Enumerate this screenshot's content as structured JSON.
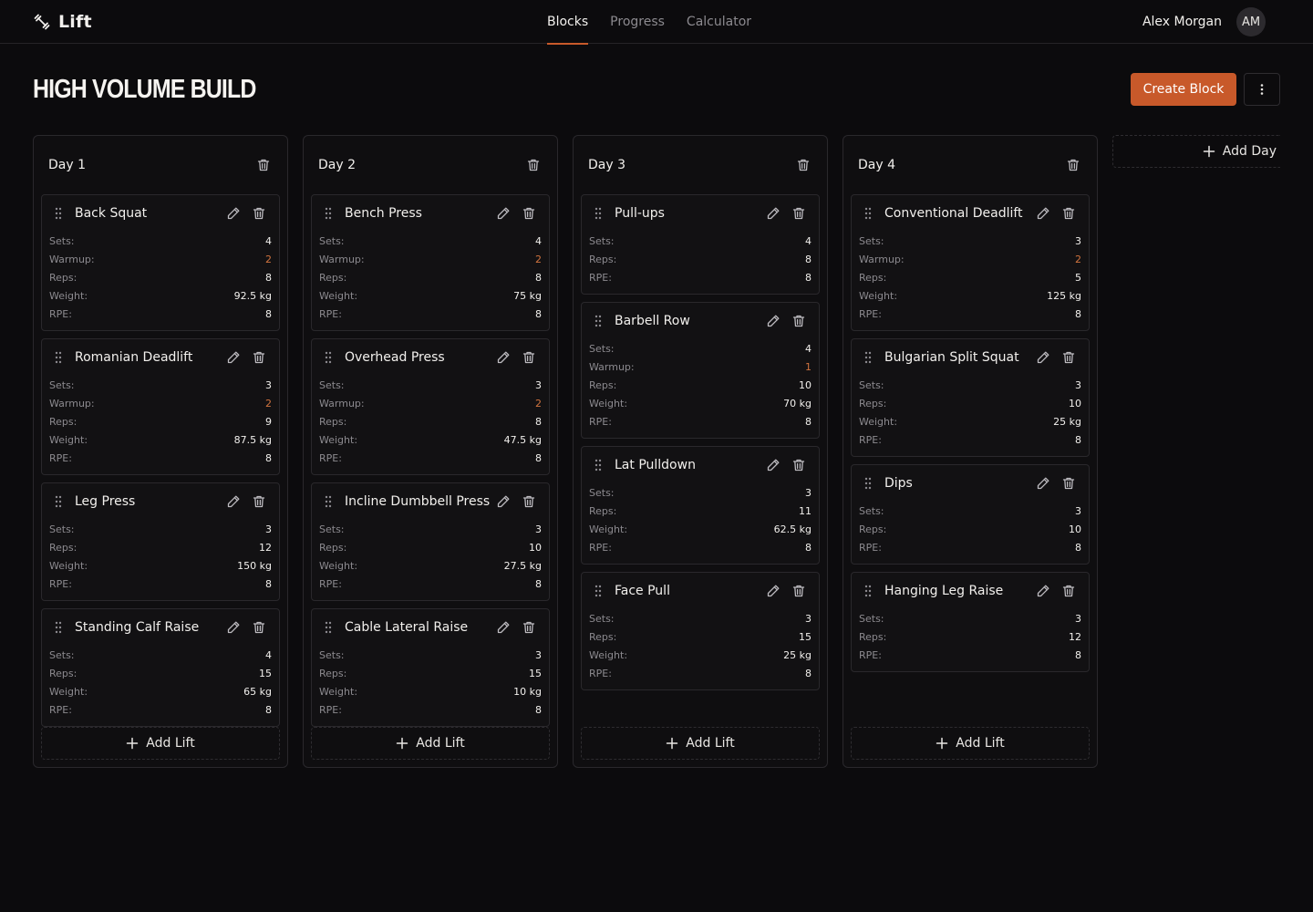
{
  "app": {
    "name": "Lift"
  },
  "nav": {
    "items": [
      "Blocks",
      "Progress",
      "Calculator"
    ],
    "active": 0
  },
  "user": {
    "name": "Alex Morgan",
    "initials": "AM"
  },
  "block": {
    "title": "HIGH VOLUME BUILD"
  },
  "actions": {
    "create_label": "Create Block",
    "add_day_label": "Add Day",
    "add_lift_label": "Add Lift"
  },
  "labels": {
    "sets": "Sets:",
    "warmup": "Warmup:",
    "reps": "Reps:",
    "weight": "Weight:",
    "rpe": "RPE:"
  },
  "colors": {
    "accent": "#c8592a",
    "warmup": "#d2743f"
  },
  "days": [
    {
      "title": "Day 1",
      "lifts": [
        {
          "name": "Back Squat",
          "sets": "4",
          "warmup": "2",
          "reps": "8",
          "weight": "92.5 kg",
          "rpe": "8"
        },
        {
          "name": "Romanian Deadlift",
          "sets": "3",
          "warmup": "2",
          "reps": "9",
          "weight": "87.5 kg",
          "rpe": "8"
        },
        {
          "name": "Leg Press",
          "sets": "3",
          "reps": "12",
          "weight": "150 kg",
          "rpe": "8"
        },
        {
          "name": "Standing Calf Raise",
          "sets": "4",
          "reps": "15",
          "weight": "65 kg",
          "rpe": "8"
        }
      ]
    },
    {
      "title": "Day 2",
      "lifts": [
        {
          "name": "Bench Press",
          "sets": "4",
          "warmup": "2",
          "reps": "8",
          "weight": "75 kg",
          "rpe": "8"
        },
        {
          "name": "Overhead Press",
          "sets": "3",
          "warmup": "2",
          "reps": "8",
          "weight": "47.5 kg",
          "rpe": "8"
        },
        {
          "name": "Incline Dumbbell Press",
          "sets": "3",
          "reps": "10",
          "weight": "27.5 kg",
          "rpe": "8"
        },
        {
          "name": "Cable Lateral Raise",
          "sets": "3",
          "reps": "15",
          "weight": "10 kg",
          "rpe": "8"
        }
      ]
    },
    {
      "title": "Day 3",
      "lifts": [
        {
          "name": "Pull-ups",
          "sets": "4",
          "reps": "8",
          "rpe": "8"
        },
        {
          "name": "Barbell Row",
          "sets": "4",
          "warmup": "1",
          "reps": "10",
          "weight": "70 kg",
          "rpe": "8"
        },
        {
          "name": "Lat Pulldown",
          "sets": "3",
          "reps": "11",
          "weight": "62.5 kg",
          "rpe": "8"
        },
        {
          "name": "Face Pull",
          "sets": "3",
          "reps": "15",
          "weight": "25 kg",
          "rpe": "8"
        }
      ]
    },
    {
      "title": "Day 4",
      "lifts": [
        {
          "name": "Conventional Deadlift",
          "sets": "3",
          "warmup": "2",
          "reps": "5",
          "weight": "125 kg",
          "rpe": "8"
        },
        {
          "name": "Bulgarian Split Squat",
          "sets": "3",
          "reps": "10",
          "weight": "25 kg",
          "rpe": "8"
        },
        {
          "name": "Dips",
          "sets": "3",
          "reps": "10",
          "rpe": "8"
        },
        {
          "name": "Hanging Leg Raise",
          "sets": "3",
          "reps": "12",
          "rpe": "8"
        }
      ]
    }
  ]
}
